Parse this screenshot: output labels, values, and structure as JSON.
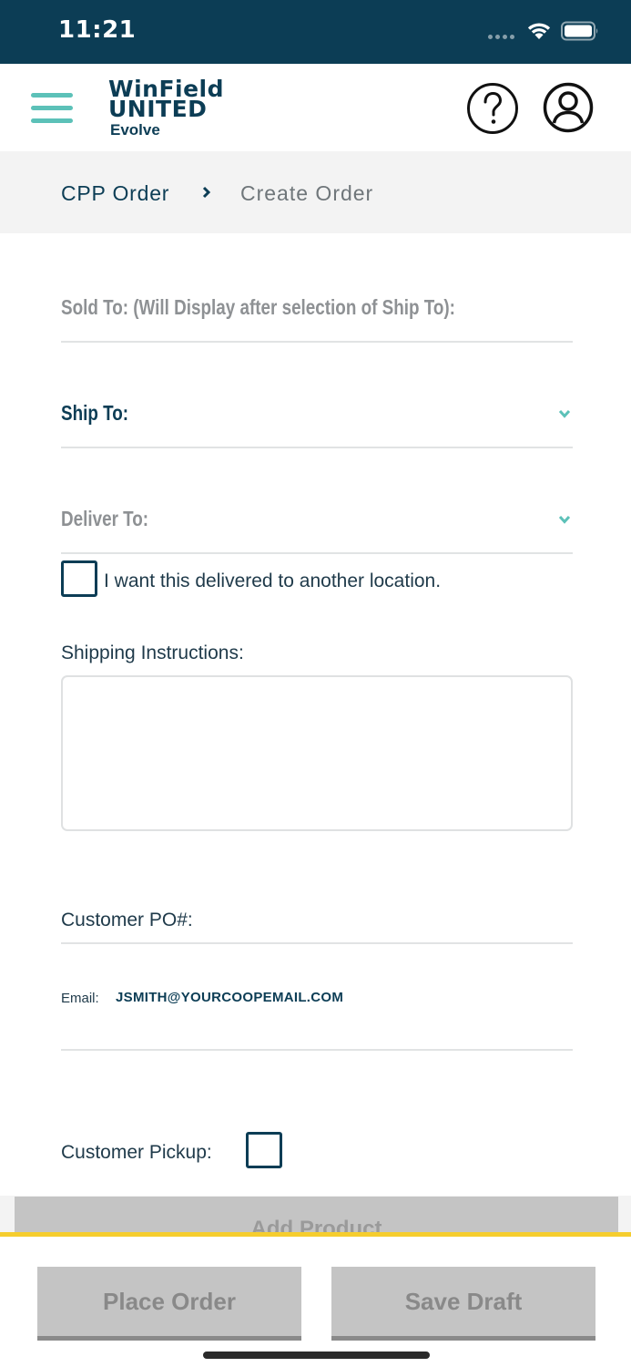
{
  "status_bar": {
    "time": "11:21"
  },
  "header": {
    "logo_line1": "WinField",
    "logo_line2": "UNITED",
    "logo_sub": "Evolve"
  },
  "breadcrumb": {
    "parent": "CPP Order",
    "current": "Create Order"
  },
  "form": {
    "sold_to_label": "Sold To: (Will Display after selection of Ship To):",
    "ship_to_label": "Ship To:",
    "deliver_to_label": "Deliver To:",
    "deliver_other_label": "I want this delivered to another location.",
    "shipping_instructions_label": "Shipping Instructions:",
    "shipping_instructions_value": "",
    "customer_po_label": "Customer PO#:",
    "email_label": "Email:",
    "email_value": "JSMITH@YOURCOOPEMAIL.COM",
    "customer_pickup_label": "Customer Pickup:",
    "deliver_other_checked": false,
    "customer_pickup_checked": false
  },
  "buttons": {
    "add_product": "Add Product",
    "place_order": "Place Order",
    "save_draft": "Save Draft"
  },
  "colors": {
    "brand_navy": "#0c3d55",
    "accent_teal": "#5cc1b8",
    "accent_yellow": "#f5cd2e",
    "disabled_gray": "#c4c4c4"
  },
  "icons": {
    "menu": "hamburger-icon",
    "help": "question-circle-icon",
    "account": "user-circle-icon",
    "breadcrumb_sep": "chevron-right-icon",
    "dropdown": "chevron-down-icon"
  }
}
